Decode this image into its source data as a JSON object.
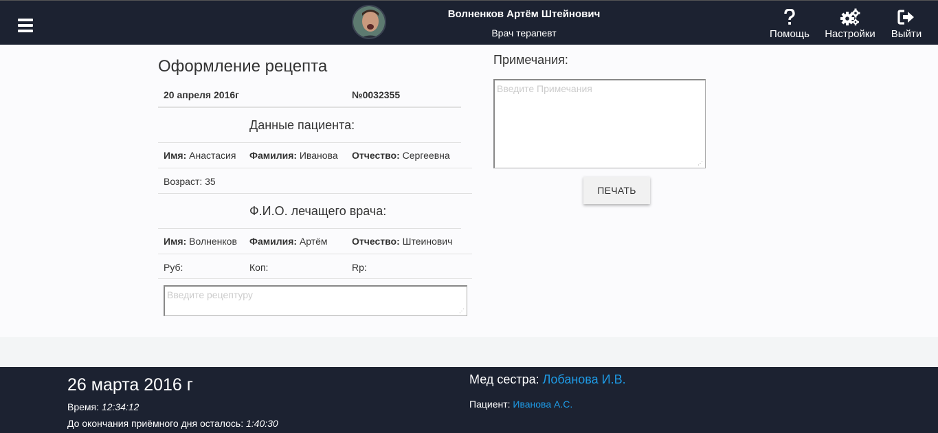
{
  "header": {
    "user_name": "Волненков Артём Штейнович",
    "user_role": "Врач терапевт",
    "help_label": "Помощь",
    "settings_label": "Настройки",
    "logout_label": "Выйти"
  },
  "form": {
    "title": "Оформление рецепта",
    "date": "20 апреля 2016г",
    "number": "№0032355",
    "patient_section": "Данные пациента:",
    "patient": {
      "first_name_label": "Имя:",
      "first_name": "Анастасия",
      "last_name_label": "Фамилия:",
      "last_name": "Иванова",
      "patronymic_label": "Отчество:",
      "patronymic": "Сергеевна",
      "age_text": "Возраст: 35"
    },
    "doctor_section": "Ф.И.О. лечащего врача:",
    "doctor": {
      "first_name_label": "Имя:",
      "first_name": "Волненков",
      "last_name_label": "Фамилия:",
      "last_name": "Артём",
      "patronymic_label": "Отчество:",
      "patronymic": "Штеинович"
    },
    "rub_label": "Руб:",
    "kop_label": "Коп:",
    "rp_label": "Rp:",
    "recipe_placeholder": "Введите рецептуру"
  },
  "notes": {
    "label": "Примечания:",
    "placeholder": "Введите Примечания"
  },
  "print_label": "ПЕЧАТЬ",
  "footer": {
    "date": "26 марта 2016 г",
    "time_label": "Время:",
    "time_value": "12:34:12",
    "remaining_label": "До окончания приёмного дня осталось:",
    "remaining_value": "1:40:30",
    "nurse_label": "Мед сестра:",
    "nurse_name": "Лобанова И.В.",
    "patient_label": "Пациент:",
    "patient_name": "Иванова А.С."
  },
  "colors": {
    "header_bg": "#1c2231",
    "link": "#1e9be6"
  }
}
